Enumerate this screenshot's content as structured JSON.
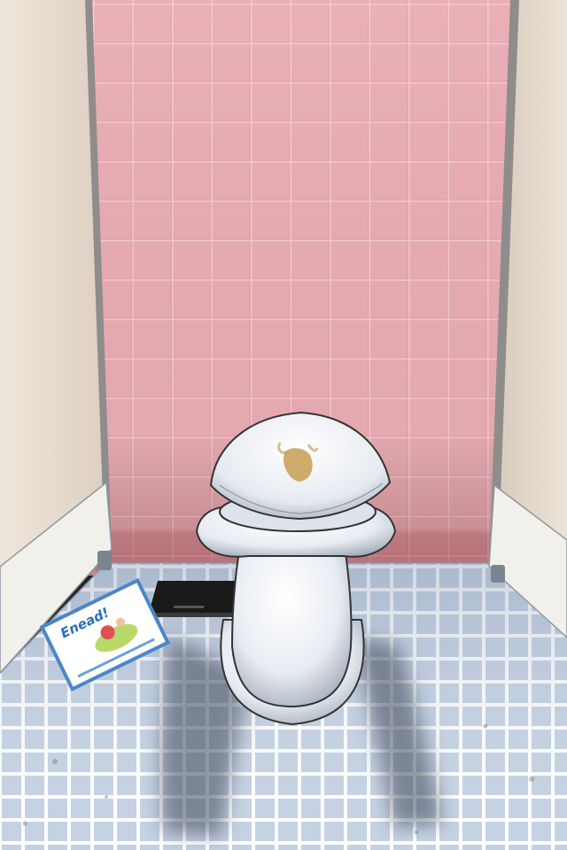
{
  "scene": {
    "colors": {
      "tile_wall": "#e7a6ae",
      "grout_wall": "#f1c3c8",
      "partition": "#e8ddd1",
      "floor_tile": "#c5d2e2",
      "floor_grout": "#ffffff",
      "toilet": "#eef1f5",
      "stain": "#c9a25a",
      "shadow": "#3c4658"
    },
    "items": [
      {
        "name": "toilet",
        "icon": "toilet-icon"
      },
      {
        "name": "scale",
        "icon": "scale-icon"
      },
      {
        "name": "magazine",
        "icon": "magazine-icon"
      },
      {
        "name": "stain",
        "icon": "stain-icon"
      }
    ]
  },
  "magazine": {
    "cover_title": "Enead!"
  }
}
